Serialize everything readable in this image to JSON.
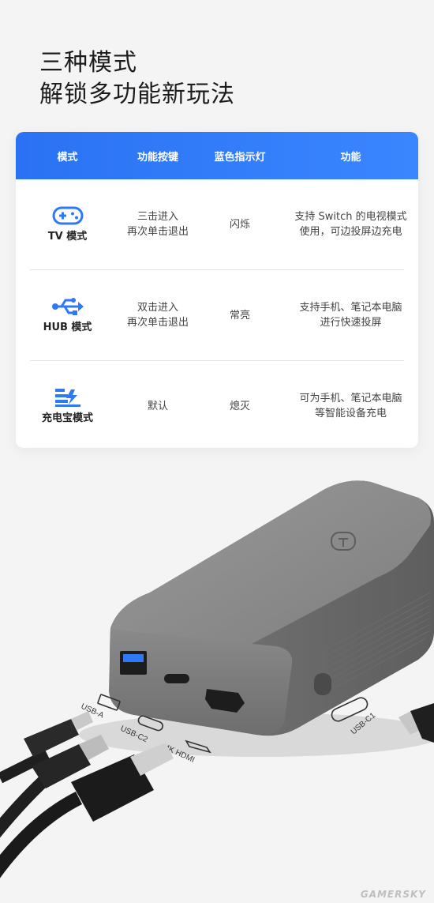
{
  "headline": {
    "line1": "三种模式",
    "line2": "解锁多功能新玩法"
  },
  "table": {
    "headers": [
      "模式",
      "功能按键",
      "蓝色指示灯",
      "功能"
    ],
    "rows": [
      {
        "icon": "gamepad-icon",
        "mode": "TV 模式",
        "key": "三击进入\n再次单击退出",
        "light": "闪烁",
        "function": "支持 Switch 的电视模式\n使用，可边投屏边充电"
      },
      {
        "icon": "usb-icon",
        "mode": "HUB 模式",
        "key": "双击进入\n再次单击退出",
        "light": "常亮",
        "function": "支持手机、笔记本电脑\n进行快速投屏"
      },
      {
        "icon": "charging-battery-icon",
        "mode": "充电宝模式",
        "key": "默认",
        "light": "熄灭",
        "function": "可为手机、笔记本电脑\n等智能设备充电"
      }
    ],
    "accent_color": "#2f78f6"
  },
  "product": {
    "port_labels": {
      "usb_a": "USB-A",
      "usb_c2": "USB-C2",
      "hdmi": "4K HDMI",
      "usb_c1": "USB-C1"
    }
  },
  "watermark": "GAMERSKY"
}
